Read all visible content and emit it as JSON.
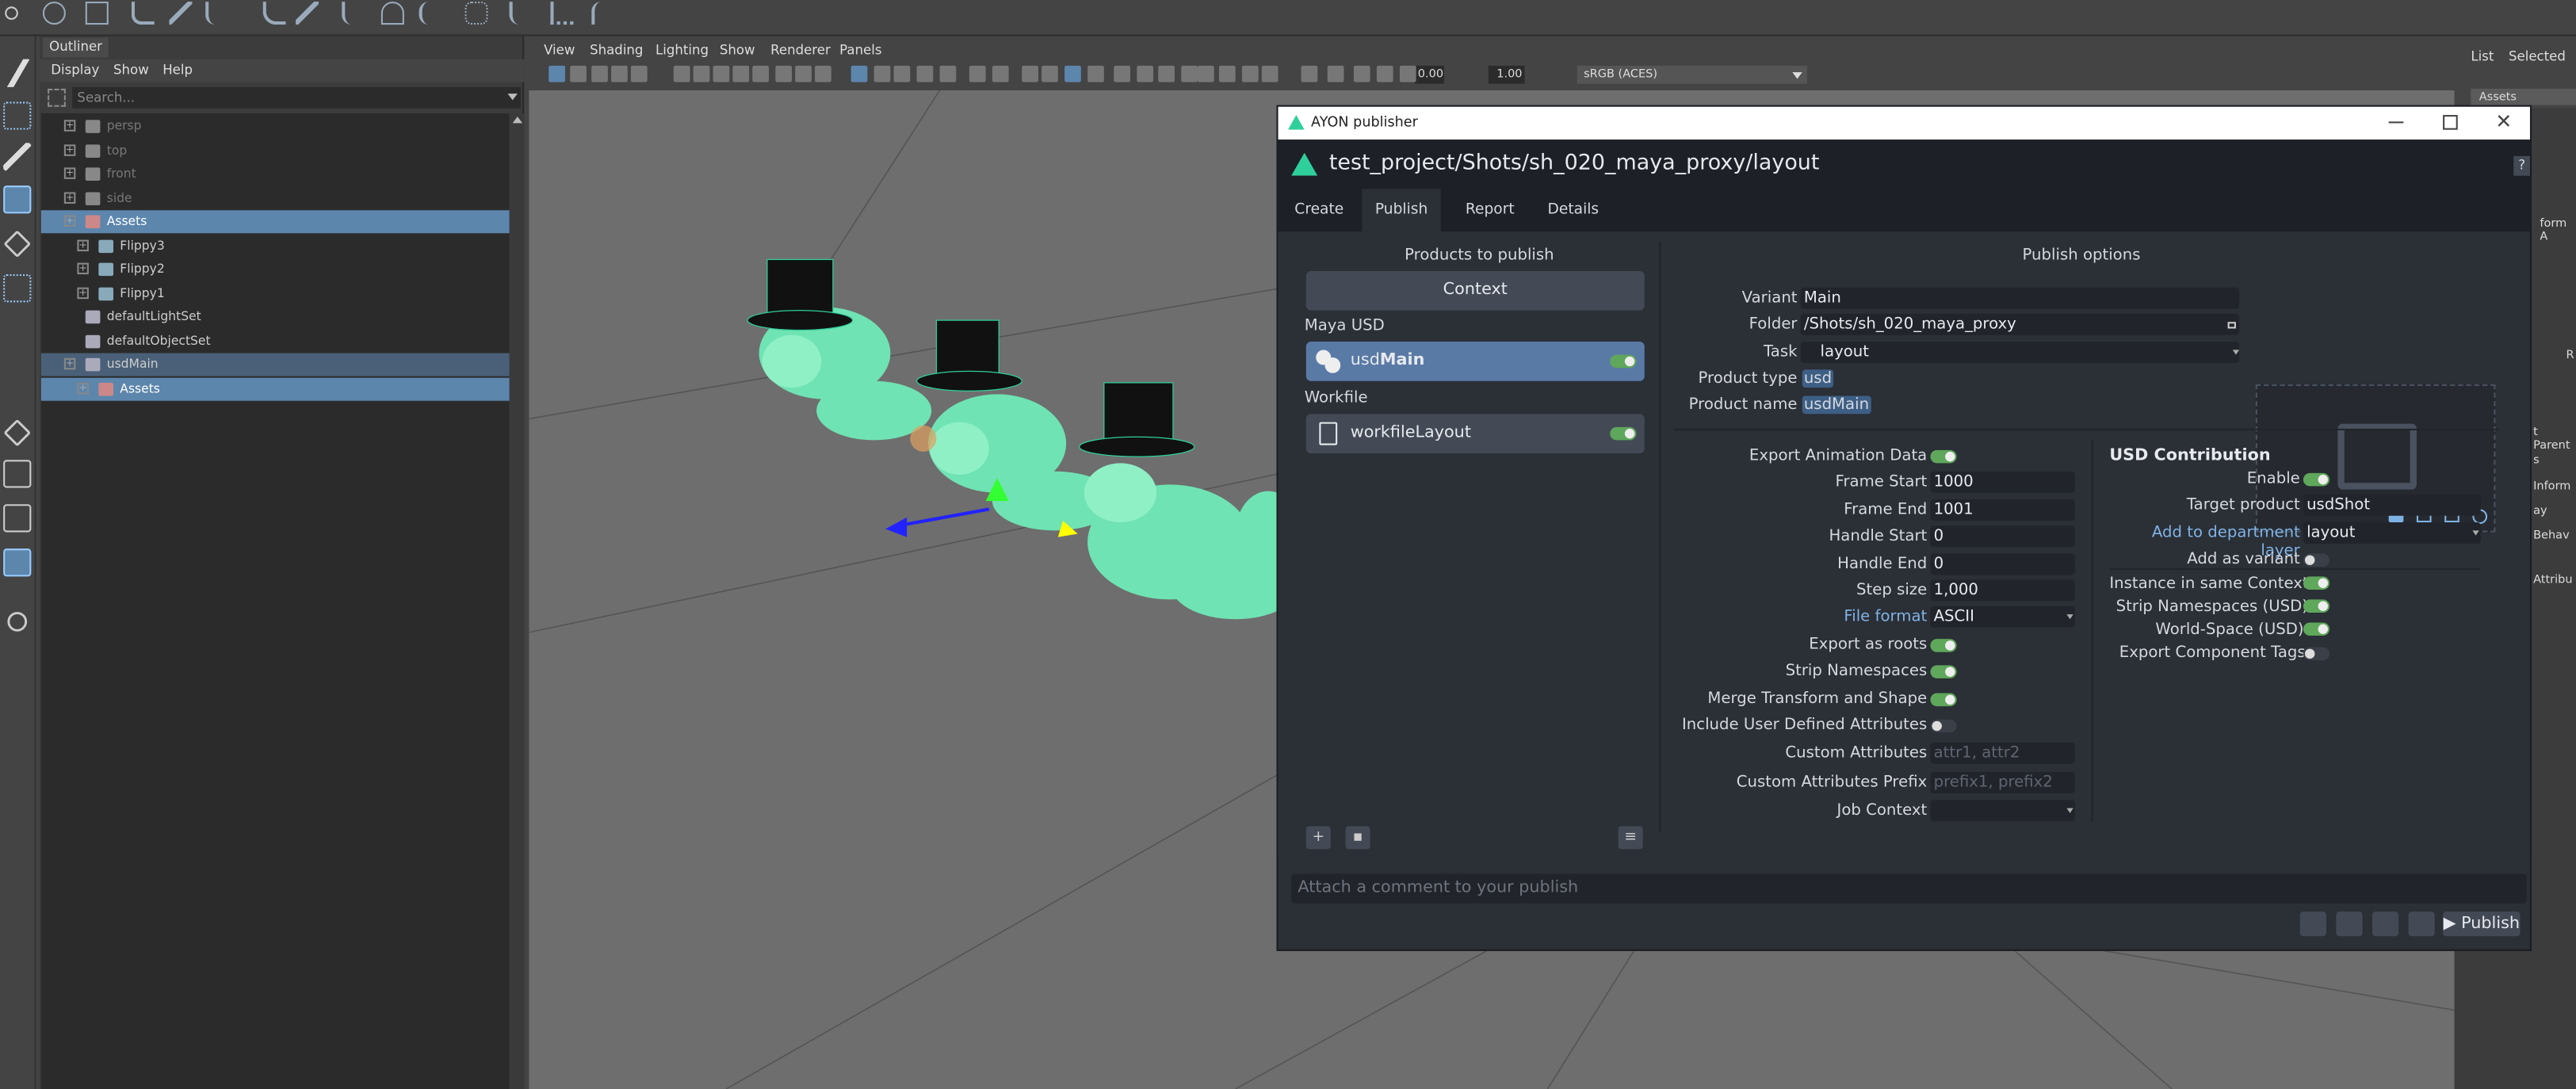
{
  "outliner": {
    "tab": "Outliner",
    "menu": [
      "Display",
      "Show",
      "Help"
    ],
    "search_placeholder": "Search...",
    "rows": [
      {
        "label": "persp",
        "type": "camera",
        "dim": true
      },
      {
        "label": "top",
        "type": "camera",
        "dim": true
      },
      {
        "label": "front",
        "type": "camera",
        "dim": true
      },
      {
        "label": "side",
        "type": "camera",
        "dim": true
      },
      {
        "label": "Assets",
        "type": "xform",
        "selected": true
      },
      {
        "label": "Flippy3",
        "type": "mesh"
      },
      {
        "label": "Flippy2",
        "type": "mesh"
      },
      {
        "label": "Flippy1",
        "type": "mesh"
      },
      {
        "label": "defaultLightSet",
        "type": "set"
      },
      {
        "label": "defaultObjectSet",
        "type": "set"
      },
      {
        "label": "usdMain",
        "type": "set",
        "sub": true
      },
      {
        "label": "Assets",
        "type": "xform",
        "selected": true
      }
    ]
  },
  "viewport": {
    "menu": [
      "View",
      "Shading",
      "Lighting",
      "Show",
      "Renderer",
      "Panels"
    ],
    "exposure": "0.00",
    "gamma": "1.00",
    "colorspace": "sRGB (ACES)"
  },
  "right_panel": {
    "tabs": [
      "List",
      "Selected"
    ],
    "header": "Assets",
    "items": [
      "form A",
      "R",
      "t Parent",
      "s",
      "Inform",
      "ay",
      "Behav",
      "Attribu"
    ]
  },
  "publisher": {
    "window_title": "AYON publisher",
    "context_path": "test_project/Shots/sh_020_maya_proxy/layout",
    "help": "?",
    "tabs": [
      "Create",
      "Publish",
      "Report",
      "Details"
    ],
    "active_tab": "Publish",
    "products_header": "Products to publish",
    "context_label": "Context",
    "groups": [
      {
        "name": "Maya USD",
        "items": [
          {
            "label_prefix": "usd",
            "label_bold": "Main",
            "icon": "usd-icon",
            "active": true
          }
        ]
      },
      {
        "name": "Workfile",
        "items": [
          {
            "label_prefix": "workfileLayout",
            "label_bold": "",
            "icon": "file-icon",
            "active": false
          }
        ]
      }
    ],
    "options_header": "Publish options",
    "general": {
      "variant_label": "Variant",
      "variant": "Main",
      "folder_label": "Folder",
      "folder": "/Shots/sh_020_maya_proxy",
      "task_label": "Task",
      "task": "layout",
      "product_type_label": "Product type",
      "product_type": "usd",
      "product_name_label": "Product name",
      "product_name": "usdMain"
    },
    "attrs": [
      {
        "label": "Export Animation Data",
        "kind": "toggle",
        "on": true
      },
      {
        "label": "Frame Start",
        "kind": "input",
        "value": "1000"
      },
      {
        "label": "Frame End",
        "kind": "input",
        "value": "1001"
      },
      {
        "label": "Handle Start",
        "kind": "input",
        "value": "0"
      },
      {
        "label": "Handle End",
        "kind": "input",
        "value": "0"
      },
      {
        "label": "Step size",
        "kind": "input",
        "value": "1,000"
      },
      {
        "label": "File format",
        "kind": "select",
        "value": "ASCII",
        "link": true
      },
      {
        "label": "Export as roots",
        "kind": "toggle",
        "on": true
      },
      {
        "label": "Strip Namespaces",
        "kind": "toggle",
        "on": true
      },
      {
        "label": "Merge Transform and Shape",
        "kind": "toggle",
        "on": true
      },
      {
        "label": "Include User Defined Attributes",
        "kind": "toggle",
        "on": false
      },
      {
        "label": "Custom Attributes",
        "kind": "input",
        "placeholder": "attr1, attr2"
      },
      {
        "label": "Custom Attributes Prefix",
        "kind": "input",
        "placeholder": "prefix1, prefix2"
      },
      {
        "label": "Job Context",
        "kind": "select",
        "value": ""
      }
    ],
    "usd": {
      "header": "USD Contribution",
      "enable_label": "Enable",
      "target_product_label": "Target product",
      "target_product": "usdShot",
      "department_label": "Add to department layer",
      "department": "layout",
      "variant_label": "Add as variant",
      "instance_label": "Instance in same Context",
      "strip_ns_label": "Strip Namespaces (USD)",
      "world_space_label": "World-Space (USD)",
      "component_tags_label": "Export Component Tags"
    },
    "comment_placeholder": "Attach a comment to your publish",
    "publish_button": "Publish",
    "colors": {
      "accent": "#5a7aa6",
      "toggle_on": "#5fa75b",
      "link": "#7fb3e6",
      "ayon": "#2fcf9b"
    }
  }
}
